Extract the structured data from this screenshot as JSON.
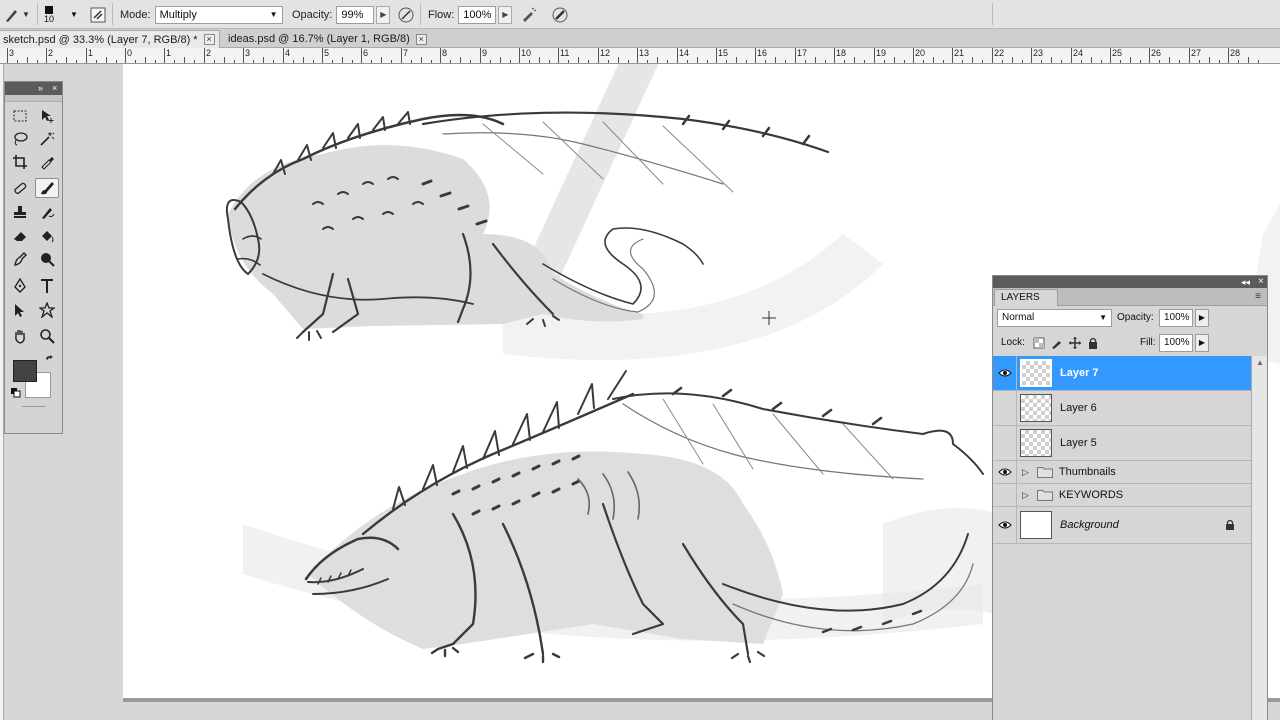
{
  "options_bar": {
    "brush_size": "10",
    "mode_label": "Mode:",
    "mode_value": "Multiply",
    "opacity_label": "Opacity:",
    "opacity_value": "99%",
    "flow_label": "Flow:",
    "flow_value": "100%"
  },
  "tabs": [
    {
      "label": "sketch.psd @ 33.3% (Layer 7, RGB/8) *",
      "close": "×"
    },
    {
      "label": "ideas.psd @ 16.7% (Layer 1, RGB/8)",
      "close": "×"
    }
  ],
  "ruler": [
    "3",
    "2",
    "1",
    "0",
    "1",
    "2",
    "3",
    "4",
    "5",
    "6",
    "7",
    "8",
    "9",
    "10",
    "11",
    "12",
    "13",
    "14",
    "15",
    "16",
    "17",
    "18",
    "19",
    "20",
    "21",
    "22",
    "23",
    "24",
    "25",
    "26",
    "27",
    "28"
  ],
  "tools_panel": {
    "collapse_glyph": "»",
    "close_glyph": "×",
    "icons": [
      "marquee-icon",
      "move-icon",
      "lasso-icon",
      "magic-wand-icon",
      "crop-icon",
      "eyedropper-icon",
      "healing-brush-icon",
      "brush-icon",
      "clone-stamp-icon",
      "history-brush-icon",
      "eraser-icon",
      "paint-bucket-icon",
      "blur-icon",
      "dodge-icon",
      "pen-icon",
      "type-icon",
      "path-select-icon",
      "shape-icon",
      "hand-icon",
      "zoom-icon"
    ],
    "fg_color": "#434343",
    "bg_color": "#ffffff"
  },
  "layers_panel": {
    "tab": "LAYERS",
    "blend_mode": "Normal",
    "opacity_label": "Opacity:",
    "opacity_value": "100%",
    "lock_label": "Lock:",
    "fill_label": "Fill:",
    "fill_value": "100%",
    "accent": "#3399ff",
    "layers": [
      {
        "name": "Layer 7",
        "visible": true,
        "active": true
      },
      {
        "name": "Layer 6",
        "visible": false
      },
      {
        "name": "Layer 5",
        "visible": false
      },
      {
        "name": "Thumbnails",
        "visible": true,
        "group": true
      },
      {
        "name": "KEYWORDS",
        "visible": false,
        "group": true
      },
      {
        "name": "Background",
        "visible": true,
        "locked": true
      }
    ]
  }
}
